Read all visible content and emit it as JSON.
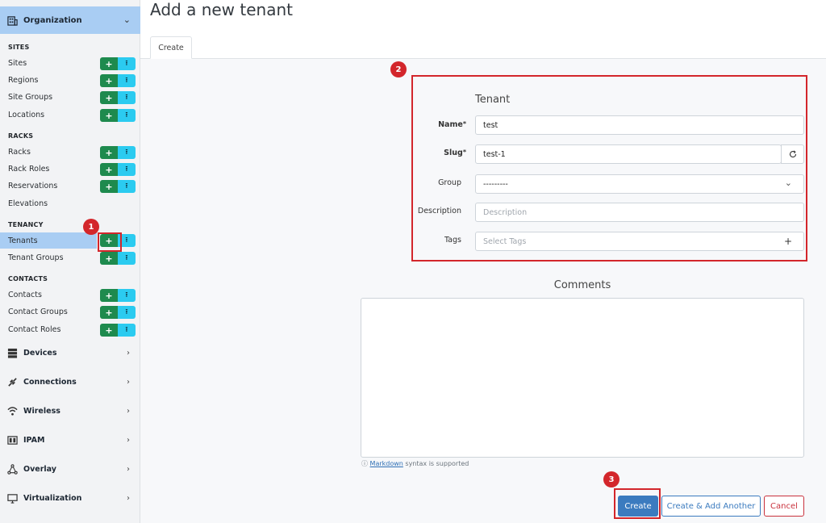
{
  "sidebar": {
    "org_label": "Organization",
    "sections": {
      "sites": "SITES",
      "racks": "RACKS",
      "tenancy": "TENANCY",
      "contacts": "CONTACTS"
    },
    "items": {
      "sites": "Sites",
      "regions": "Regions",
      "site_groups": "Site Groups",
      "locations": "Locations",
      "racks": "Racks",
      "rack_roles": "Rack Roles",
      "reservations": "Reservations",
      "elevations": "Elevations",
      "tenants": "Tenants",
      "tenant_groups": "Tenant Groups",
      "contacts": "Contacts",
      "contact_groups": "Contact Groups",
      "contact_roles": "Contact Roles"
    },
    "menus": {
      "devices": "Devices",
      "connections": "Connections",
      "wireless": "Wireless",
      "ipam": "IPAM",
      "overlay": "Overlay",
      "virtualization": "Virtualization"
    },
    "add_glyph": "+",
    "import_glyph": "⭱"
  },
  "page": {
    "title": "Add a new tenant",
    "tab": "Create"
  },
  "form": {
    "section_title": "Tenant",
    "name_label": "Name",
    "name_value": "test",
    "slug_label": "Slug",
    "slug_value": "test-1",
    "group_label": "Group",
    "group_value": "---------",
    "description_label": "Description",
    "description_placeholder": "Description",
    "tags_label": "Tags",
    "tags_placeholder": "Select Tags",
    "comments_title": "Comments",
    "markdown_link": "Markdown",
    "markdown_suffix": "syntax is supported"
  },
  "buttons": {
    "create": "Create",
    "create_another": "Create & Add Another",
    "cancel": "Cancel"
  },
  "markers": {
    "one": "1",
    "two": "2",
    "three": "3"
  },
  "colors": {
    "accent": "#a9cdf3",
    "add_green": "#1e8a4e",
    "import_cyan": "#2bcbf0",
    "primary": "#3b7bbf",
    "danger": "#c9323d",
    "annotation": "#d3262b"
  }
}
